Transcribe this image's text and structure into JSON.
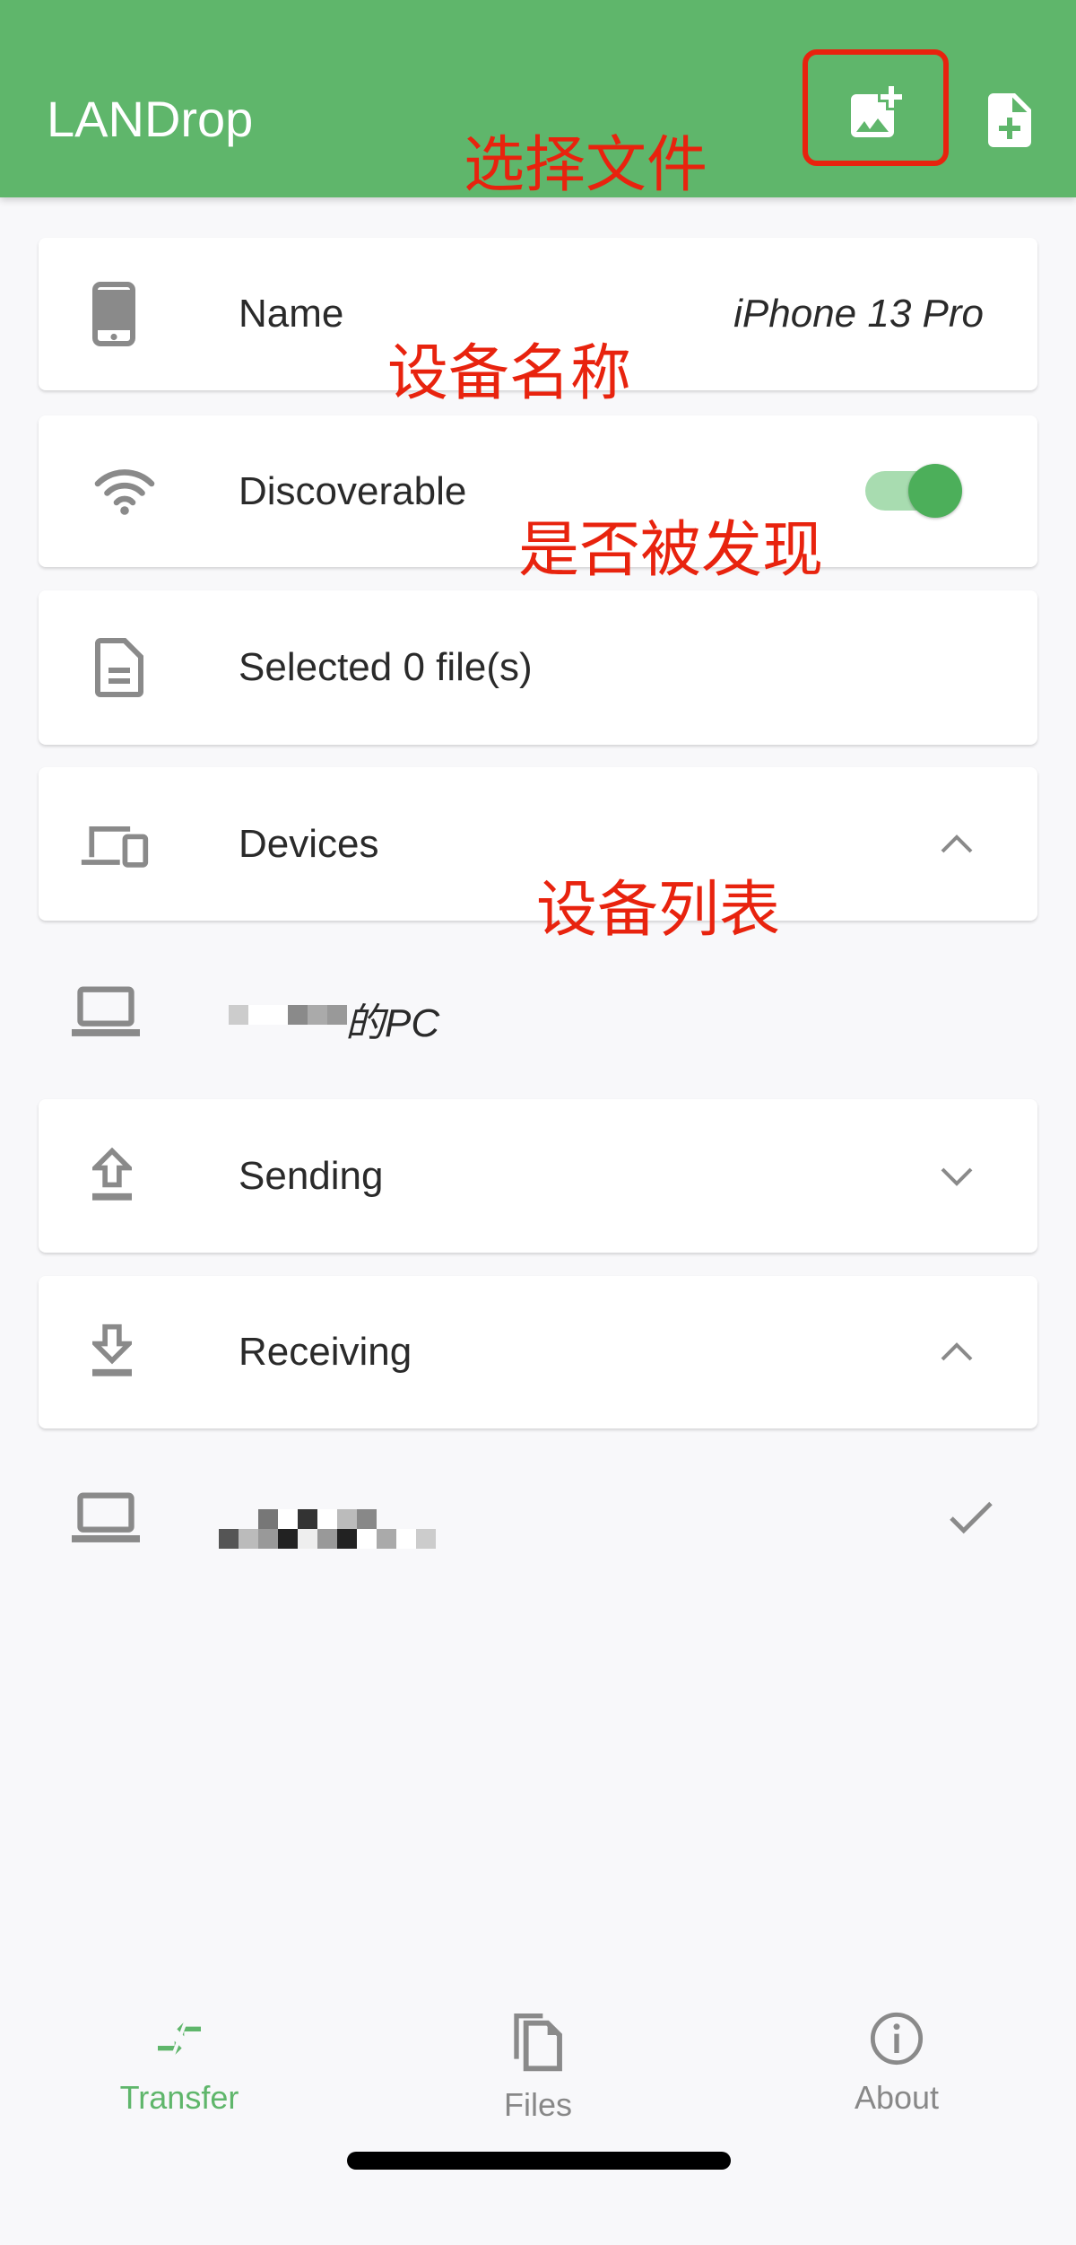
{
  "appbar": {
    "title": "LANDrop",
    "actions": [
      {
        "icon": "add-photo-icon"
      },
      {
        "icon": "note-add-icon"
      }
    ]
  },
  "annotations": {
    "select_files": "选择文件",
    "device_name": "设备名称",
    "discoverable": "是否被发现",
    "device_list": "设备列表"
  },
  "cards": {
    "name": {
      "label": "Name",
      "value": "iPhone 13 Pro",
      "icon": "phone-icon"
    },
    "discoverable": {
      "label": "Discoverable",
      "icon": "wifi-icon",
      "enabled": true
    },
    "selected": {
      "label": "Selected 0 file(s)",
      "icon": "file-icon"
    },
    "devices": {
      "label": "Devices",
      "icon": "devices-icon",
      "expanded": true
    },
    "sending": {
      "label": "Sending",
      "icon": "upload-icon",
      "expanded": false
    },
    "receiving": {
      "label": "Receiving",
      "icon": "download-icon",
      "expanded": true
    }
  },
  "devices": [
    {
      "name_suffix": "的PC",
      "icon": "laptop-icon"
    }
  ],
  "receiving": [
    {
      "icon": "laptop-icon",
      "status": "check-icon"
    }
  ],
  "nav": [
    {
      "label": "Transfer",
      "active": true
    },
    {
      "label": "Files"
    },
    {
      "label": "About"
    }
  ],
  "colors": {
    "primary": "#5fb66b",
    "annotation": "#e8230e",
    "icon": "#8a8a8a"
  }
}
